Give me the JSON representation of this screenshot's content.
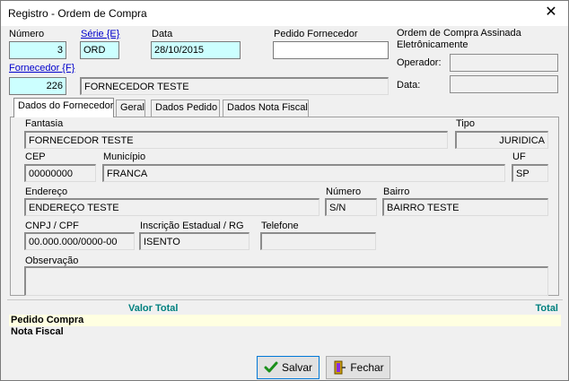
{
  "window": {
    "title": "Registro - Ordem de Compra",
    "close_glyph": "✕"
  },
  "header": {
    "numero_label": "Número",
    "numero_value": "3",
    "serie_label": "Série {E}",
    "serie_value": "ORD",
    "data_label": "Data",
    "data_value": "28/10/2015",
    "pedido_fornecedor_label": "Pedido Fornecedor",
    "pedido_fornecedor_value": "",
    "assinada_label_1": "Ordem de Compra Assinada",
    "assinada_label_2": "Eletrônicamente",
    "operador_label": "Operador:",
    "operador_value": "",
    "data2_label": "Data:",
    "data2_value": "",
    "fornecedor_label": "Fornecedor {F}",
    "fornecedor_code": "226",
    "fornecedor_name": "FORNECEDOR TESTE"
  },
  "tabs": [
    {
      "label": "Dados do Fornecedor"
    },
    {
      "label": "Geral"
    },
    {
      "label": "Dados Pedido"
    },
    {
      "label": "Dados Nota Fiscal"
    }
  ],
  "supplier": {
    "fantasia_label": "Fantasia",
    "fantasia_value": "FORNECEDOR TESTE",
    "tipo_label": "Tipo",
    "tipo_value": "JURIDICA",
    "cep_label": "CEP",
    "cep_value": "00000000",
    "municipio_label": "Município",
    "municipio_value": "FRANCA",
    "uf_label": "UF",
    "uf_value": "SP",
    "endereco_label": "Endereço",
    "endereco_value": "ENDEREÇO TESTE",
    "numero_label": "Número",
    "numero_value": "S/N",
    "bairro_label": "Bairro",
    "bairro_value": "BAIRRO TESTE",
    "cnpj_label": "CNPJ / CPF",
    "cnpj_value": "00.000.000/0000-00",
    "ie_label": "Inscrição Estadual / RG",
    "ie_value": "ISENTO",
    "telefone_label": "Telefone",
    "telefone_value": "",
    "observacao_label": "Observação",
    "observacao_value": ""
  },
  "totals": {
    "col_valor_total": "Valor Total",
    "col_total": "Total",
    "rows": [
      {
        "label": "Pedido Compra"
      },
      {
        "label": "Nota Fiscal"
      }
    ]
  },
  "buttons": {
    "salvar": "Salvar",
    "fechar": "Fechar"
  },
  "colors": {
    "cyan_field": "#ccffff",
    "link": "#0000cc",
    "grid_header": "#00807f",
    "highlight_row": "#ffffe1"
  }
}
